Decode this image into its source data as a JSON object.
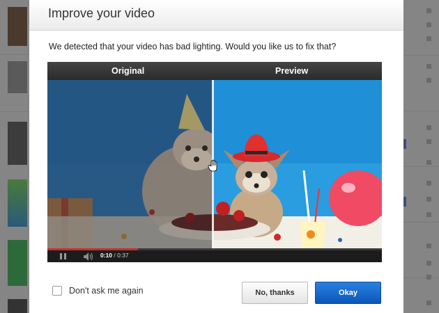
{
  "dialog": {
    "title": "Improve your video",
    "message": "We detected that your video has bad lighting.  Would you like us to fix that?"
  },
  "video": {
    "original_label": "Original",
    "preview_label": "Preview",
    "current_time": "0:10",
    "duration": "/ 0:37",
    "progress": 0.27
  },
  "footer": {
    "checkbox_label": "Don't ask me again",
    "checkbox_checked": false,
    "no_label": "No, thanks",
    "ok_label": "Okay"
  },
  "colors": {
    "accent": "#0b56b8",
    "progress": "#c4302b"
  }
}
